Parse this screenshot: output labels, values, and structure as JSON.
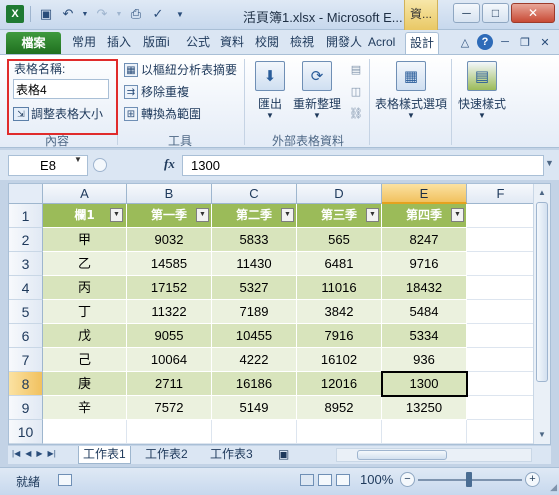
{
  "window": {
    "title": "活頁簿1.xlsx - Microsoft E...",
    "context_tab": "資...",
    "buttons": {
      "minimize": "─",
      "maximize": "□",
      "close": "✕"
    }
  },
  "quick_access": [
    "save-icon",
    "undo-icon",
    "redo-icon",
    "print-preview-icon",
    "spelling-icon",
    "customize-qat-icon"
  ],
  "ribbon_tabs": {
    "file": "檔案",
    "tabs": [
      "常用",
      "插入",
      "版面i",
      "公式",
      "資料",
      "校閱",
      "檢視",
      "開發人",
      "Acrol",
      "設計"
    ],
    "active": "設計"
  },
  "ribbon": {
    "properties": {
      "name_label": "表格名稱:",
      "name_value": "表格4",
      "resize_label": "調整表格大小",
      "group_label": "內容"
    },
    "tools": {
      "items": [
        "以樞紐分析表摘要",
        "移除重複",
        "轉換為範圍"
      ],
      "group_label": "工具"
    },
    "external": {
      "export_label": "匯出",
      "refresh_label": "重新整理",
      "group_label": "外部表格資料"
    },
    "style_options": {
      "label": "表格樣式選項"
    },
    "quick_styles": {
      "label": "快速樣式"
    }
  },
  "formula_bar": {
    "name_box": "E8",
    "fx": "fx",
    "value": "1300"
  },
  "grid": {
    "columns": [
      "A",
      "B",
      "C",
      "D",
      "E",
      "F"
    ],
    "selected_column": "E",
    "rows": [
      "1",
      "2",
      "3",
      "4",
      "5",
      "6",
      "7",
      "8",
      "9",
      "10"
    ],
    "selected_row": "8",
    "table_headers": [
      "欄1",
      "第一季",
      "第二季",
      "第三季",
      "第四季"
    ],
    "table_rows": [
      [
        "甲",
        "9032",
        "5833",
        "565",
        "8247"
      ],
      [
        "乙",
        "14585",
        "11430",
        "6481",
        "9716"
      ],
      [
        "丙",
        "17152",
        "5327",
        "11016",
        "18432"
      ],
      [
        "丁",
        "11322",
        "7189",
        "3842",
        "5484"
      ],
      [
        "戊",
        "9055",
        "10455",
        "7916",
        "5334"
      ],
      [
        "己",
        "10064",
        "4222",
        "16102",
        "936"
      ],
      [
        "庚",
        "2711",
        "16186",
        "12016",
        "1300"
      ],
      [
        "辛",
        "7572",
        "5149",
        "8952",
        "13250"
      ]
    ],
    "active_cell": "E8",
    "table_colors": {
      "header": "#9bbb59",
      "band": "#d8e4bc",
      "plain": "#ebf1de"
    }
  },
  "sheets": {
    "tabs": [
      "工作表1",
      "工作表2",
      "工作表3"
    ],
    "active": "工作表1"
  },
  "status": {
    "mode": "就緒",
    "zoom": "100%",
    "zoom_minus": "−",
    "zoom_plus": "+"
  },
  "highlight_color": "#e02b2b"
}
